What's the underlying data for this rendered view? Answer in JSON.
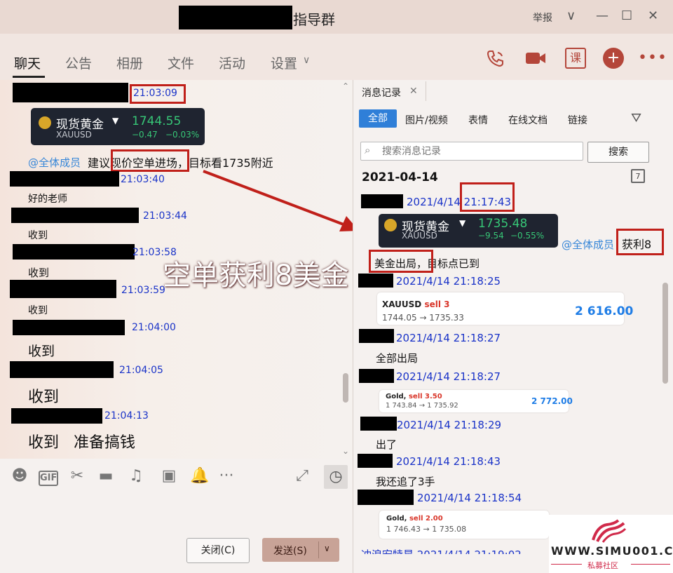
{
  "window": {
    "title": "指导群",
    "report_label": "举报",
    "controls": {
      "chevron": "∨",
      "minimize": "—",
      "maximize": "☐",
      "close": "✕"
    }
  },
  "tabs": [
    "聊天",
    "公告",
    "相册",
    "文件",
    "活动",
    "设置"
  ],
  "top_icons": {
    "course_label": "课"
  },
  "chat": {
    "msg1_time": "21:03:09",
    "gold_card": {
      "name": "现货黄金",
      "symbol": "XAUUSD",
      "price": "1744.55",
      "change": "−0.47",
      "change_pct": "−0.03%"
    },
    "mention": "@全体成员",
    "advice": "建议现价空单进场，目标看1735附近",
    "entries": [
      {
        "time": "21:03:40",
        "text": "好的老师"
      },
      {
        "time": "21:03:44",
        "text": "收到"
      },
      {
        "time": "21:03:58",
        "text": "收到"
      },
      {
        "time": "21:03:59",
        "text": "收到"
      },
      {
        "time": "21:04:00",
        "text": "收到"
      },
      {
        "time": "21:04:05",
        "text": "收到"
      },
      {
        "time": "21:04:13",
        "text": "收到   准备搞钱"
      }
    ]
  },
  "overlay_text": "空单获利8美金",
  "buttons": {
    "close": "关闭(C)",
    "send": "发送(S)"
  },
  "history": {
    "tab": "消息记录",
    "filters": [
      "全部",
      "图片/视频",
      "表情",
      "在线文档",
      "链接"
    ],
    "search_placeholder": "搜索消息记录",
    "search_button": "搜索",
    "date": "2021-04-14",
    "calendar_day": "7",
    "msg1_time": "2021/4/14 21:17:43",
    "gold_card": {
      "name": "现货黄金",
      "symbol": "XAUUSD",
      "price": "1735.48",
      "change": "−9.54",
      "change_pct": "−0.55%"
    },
    "mention": "@全体成员",
    "profit": "获利8",
    "exit_text": "美金出局，目标点已到",
    "records": [
      {
        "time": "2021/4/14 21:18:25"
      },
      {
        "time": "2021/4/14 21:18:27",
        "text": "全部出局"
      },
      {
        "time": "2021/4/14 21:18:27"
      },
      {
        "time": "2021/4/14 21:18:29",
        "text": "出了"
      },
      {
        "time": "2021/4/14 21:18:43",
        "text": "我还追了3手"
      },
      {
        "time": "2021/4/14 21:18:54"
      }
    ],
    "trade1": {
      "name": "XAUUSD",
      "sell": "sell 3",
      "route": "1744.05 → 1735.33",
      "profit": "2 616.00"
    },
    "trade2": {
      "name": "Gold,",
      "sell": "sell 3.50",
      "route": "1 743.84 → 1 735.92",
      "profit": "2 772.00"
    },
    "trade3": {
      "name": "Gold,",
      "sell": "sell 2.00",
      "route": "1 746.43 → 1 735.08"
    },
    "last_partial": "冲浪宏特星 2021/4/14 21:19:02"
  },
  "watermark": {
    "text": "WWW.SIMU001.CN",
    "sub": "私募社区"
  }
}
